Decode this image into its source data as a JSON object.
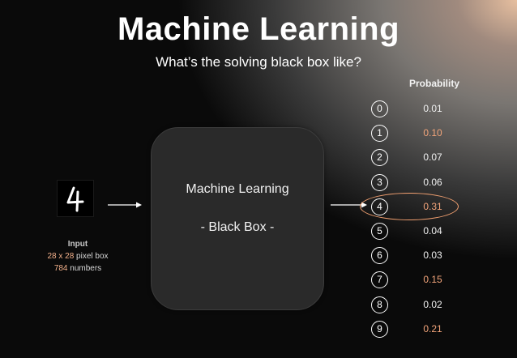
{
  "title": "Machine Learning",
  "subtitle": "What’s the solving black box like?",
  "input": {
    "digit": "4",
    "label": "Input",
    "size_value": "28 x 28",
    "size_unit": " pixel box",
    "count_value": "784",
    "count_unit": " numbers"
  },
  "black_box": {
    "line1": "Machine Learning",
    "line2": "- Black Box -"
  },
  "probability": {
    "header": "Probability",
    "rows": [
      {
        "digit": "0",
        "value": "0.01",
        "highlight": false
      },
      {
        "digit": "1",
        "value": "0.10",
        "highlight": true
      },
      {
        "digit": "2",
        "value": "0.07",
        "highlight": false
      },
      {
        "digit": "3",
        "value": "0.06",
        "highlight": false
      },
      {
        "digit": "4",
        "value": "0.31",
        "highlight": true
      },
      {
        "digit": "5",
        "value": "0.04",
        "highlight": false
      },
      {
        "digit": "6",
        "value": "0.03",
        "highlight": false
      },
      {
        "digit": "7",
        "value": "0.15",
        "highlight": true
      },
      {
        "digit": "8",
        "value": "0.02",
        "highlight": false
      },
      {
        "digit": "9",
        "value": "0.21",
        "highlight": true
      }
    ],
    "circled_row": "4"
  },
  "colors": {
    "highlight": "#f2a47a",
    "text": "#ffffff",
    "box": "#2a2a2a"
  }
}
